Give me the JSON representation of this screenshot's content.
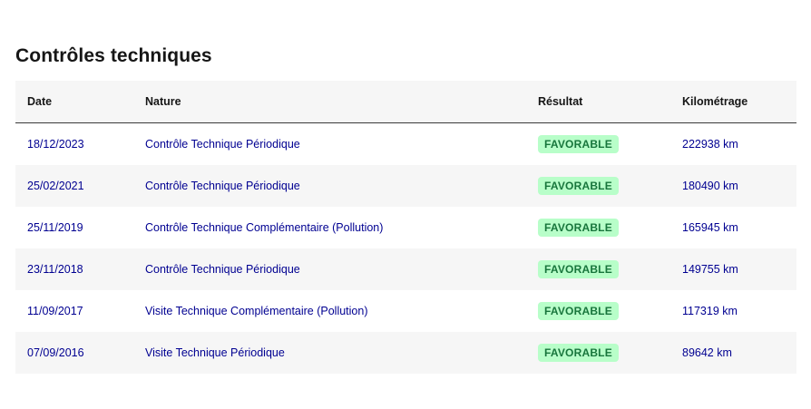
{
  "section": {
    "title": "Contrôles techniques"
  },
  "table": {
    "headers": {
      "date": "Date",
      "nature": "Nature",
      "result": "Résultat",
      "mileage": "Kilométrage"
    },
    "rows": [
      {
        "date": "18/12/2023",
        "nature": "Contrôle Technique Périodique",
        "result": "FAVORABLE",
        "mileage": "222938 km"
      },
      {
        "date": "25/02/2021",
        "nature": "Contrôle Technique Périodique",
        "result": "FAVORABLE",
        "mileage": "180490 km"
      },
      {
        "date": "25/11/2019",
        "nature": "Contrôle Technique Complémentaire (Pollution)",
        "result": "FAVORABLE",
        "mileage": "165945 km"
      },
      {
        "date": "23/11/2018",
        "nature": "Contrôle Technique Périodique",
        "result": "FAVORABLE",
        "mileage": "149755 km"
      },
      {
        "date": "11/09/2017",
        "nature": "Visite Technique Complémentaire (Pollution)",
        "result": "FAVORABLE",
        "mileage": "117319 km"
      },
      {
        "date": "07/09/2016",
        "nature": "Visite Technique Périodique",
        "result": "FAVORABLE",
        "mileage": "89642 km"
      }
    ]
  },
  "colors": {
    "link_text": "#000091",
    "badge_bg": "#b8fec9",
    "badge_text": "#18753c",
    "stripe": "#f6f6f6"
  }
}
